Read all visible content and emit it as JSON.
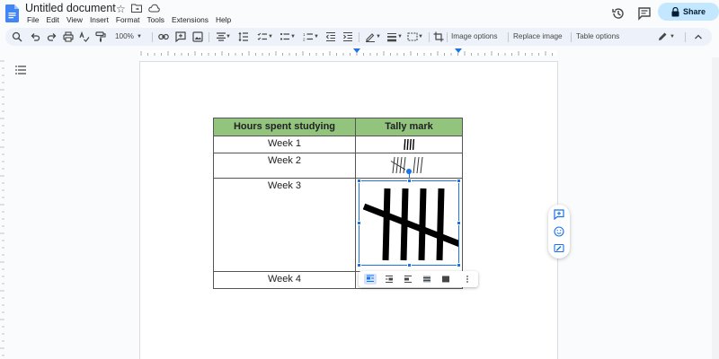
{
  "doc": {
    "title": "Untitled document"
  },
  "menu": [
    "File",
    "Edit",
    "View",
    "Insert",
    "Format",
    "Tools",
    "Extensions",
    "Help"
  ],
  "share": {
    "label": "Share"
  },
  "toolbar": {
    "zoom": "100%",
    "image_options": "Image options",
    "replace_image": "Replace image",
    "table_options": "Table options"
  },
  "table": {
    "headers": [
      "Hours spent studying",
      "Tally mark"
    ],
    "rows": [
      {
        "label": "Week 1",
        "tally": 4
      },
      {
        "label": "Week 2",
        "tally": 8
      },
      {
        "label": "Week 3",
        "tally": 5
      },
      {
        "label": "Week 4",
        "tally": 0
      }
    ]
  },
  "colors": {
    "accent": "#1a73e8",
    "share_bg": "#c2e7ff",
    "header_fill": "#93c47d",
    "toolbar_bg": "#edf2fa"
  },
  "icons": {
    "title_bar": [
      "star-icon",
      "move-to-folder-icon",
      "cloud-status-icon"
    ],
    "right": [
      "version-history-icon",
      "comments-icon",
      "lock-icon"
    ],
    "side_panel": [
      "add-comment-icon",
      "emoji-reaction-icon",
      "suggest-edits-icon"
    ]
  }
}
